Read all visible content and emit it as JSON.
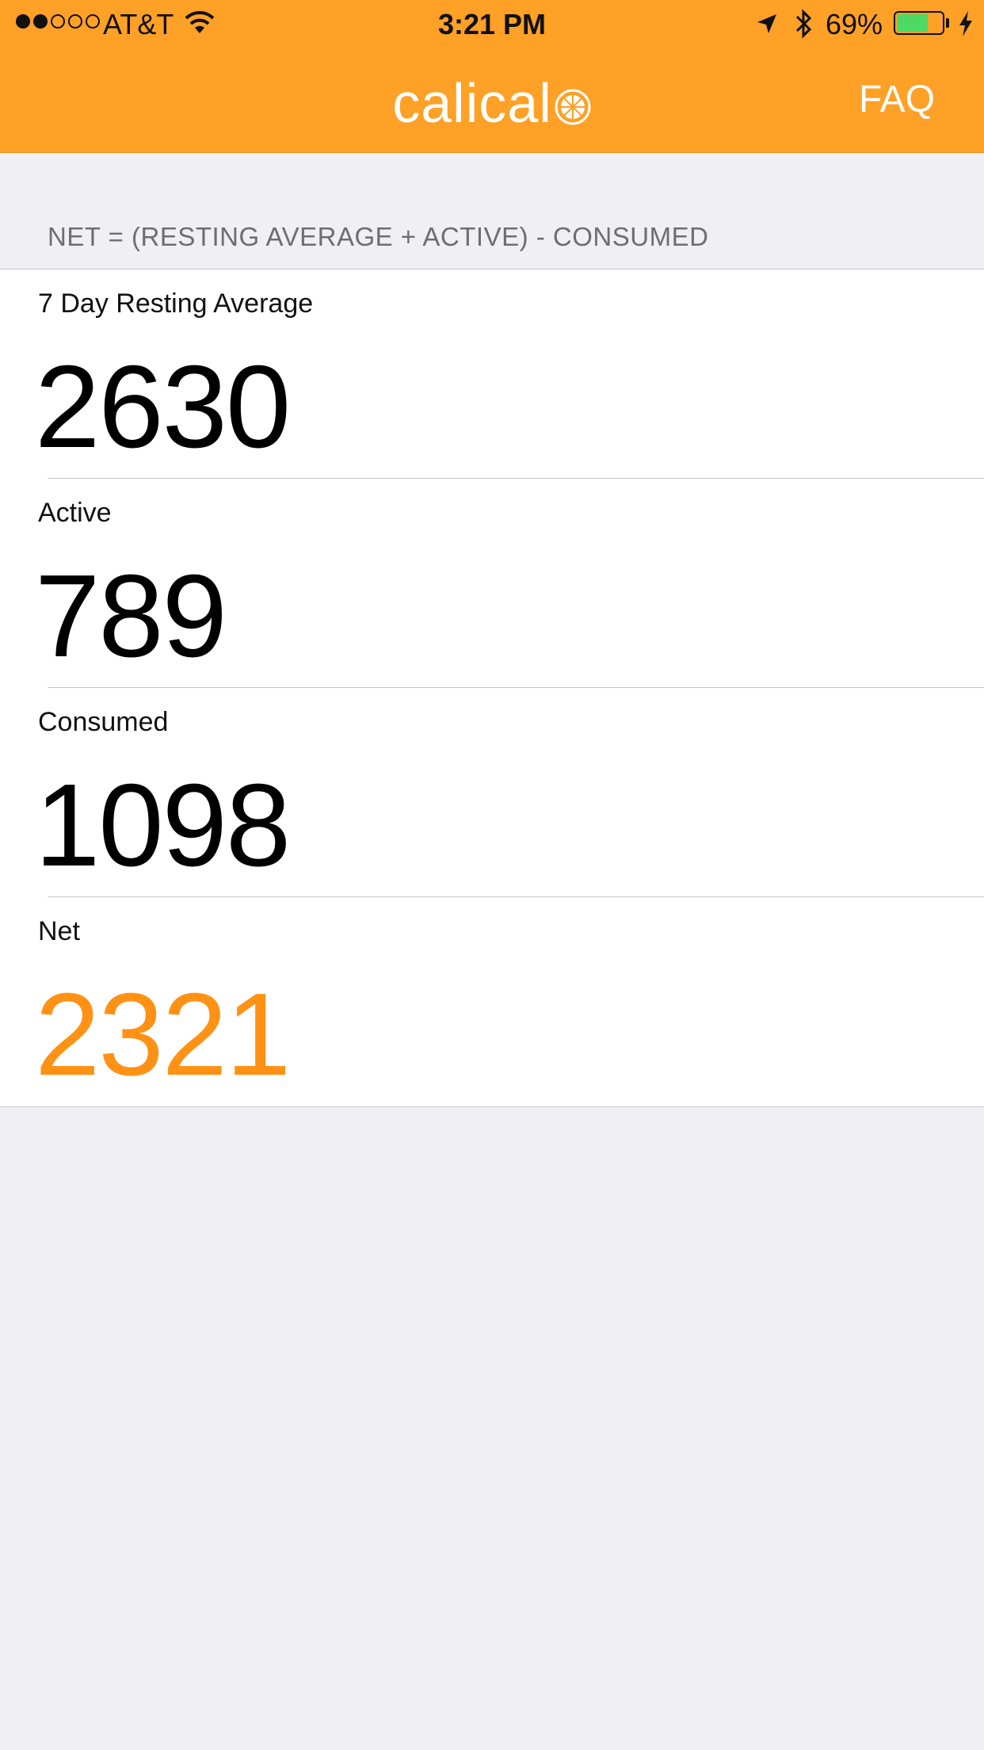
{
  "status_bar": {
    "carrier": "AT&T",
    "time": "3:21 PM",
    "battery_percent": "69%",
    "battery_level": 0.69,
    "signal_bars_filled": 2,
    "signal_bars_total": 5
  },
  "nav": {
    "logo_text": "calical",
    "faq_label": "FAQ"
  },
  "formula": "NET = (RESTING AVERAGE + ACTIVE) - CONSUMED",
  "rows": [
    {
      "label": "7 Day Resting Average",
      "value": "2630"
    },
    {
      "label": "Active",
      "value": "789"
    },
    {
      "label": "Consumed",
      "value": "1098"
    },
    {
      "label": "Net",
      "value": "2321"
    }
  ],
  "colors": {
    "brand_orange": "#FFA027",
    "accent_value": "#FF9114",
    "background": "#EFEFF4",
    "battery_green": "#4CD964"
  },
  "icons": [
    "wifi-icon",
    "location-arrow-icon",
    "bluetooth-icon",
    "battery-icon",
    "charging-bolt-icon",
    "orange-slice-logo-icon"
  ]
}
